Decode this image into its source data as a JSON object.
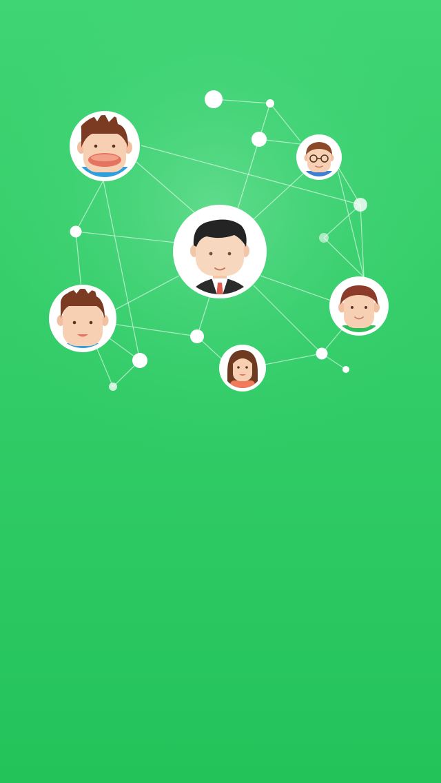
{
  "theme": {
    "background_top": "#3fd474",
    "background_bottom": "#24c35a",
    "background_glow": "#5ddc88",
    "node_fill": "#ffffff",
    "line_color": "#ffffff"
  },
  "network": {
    "avatars": [
      {
        "id": "avatar-center-businessman",
        "label": "businessman-avatar"
      },
      {
        "id": "avatar-laughing-boy",
        "label": "laughing-boy-avatar"
      },
      {
        "id": "avatar-glasses-kid",
        "label": "glasses-kid-avatar"
      },
      {
        "id": "avatar-spiky-boy",
        "label": "spiky-hair-boy-avatar"
      },
      {
        "id": "avatar-girl",
        "label": "girl-avatar"
      },
      {
        "id": "avatar-green-shirt-boy",
        "label": "green-shirt-boy-avatar"
      }
    ]
  }
}
